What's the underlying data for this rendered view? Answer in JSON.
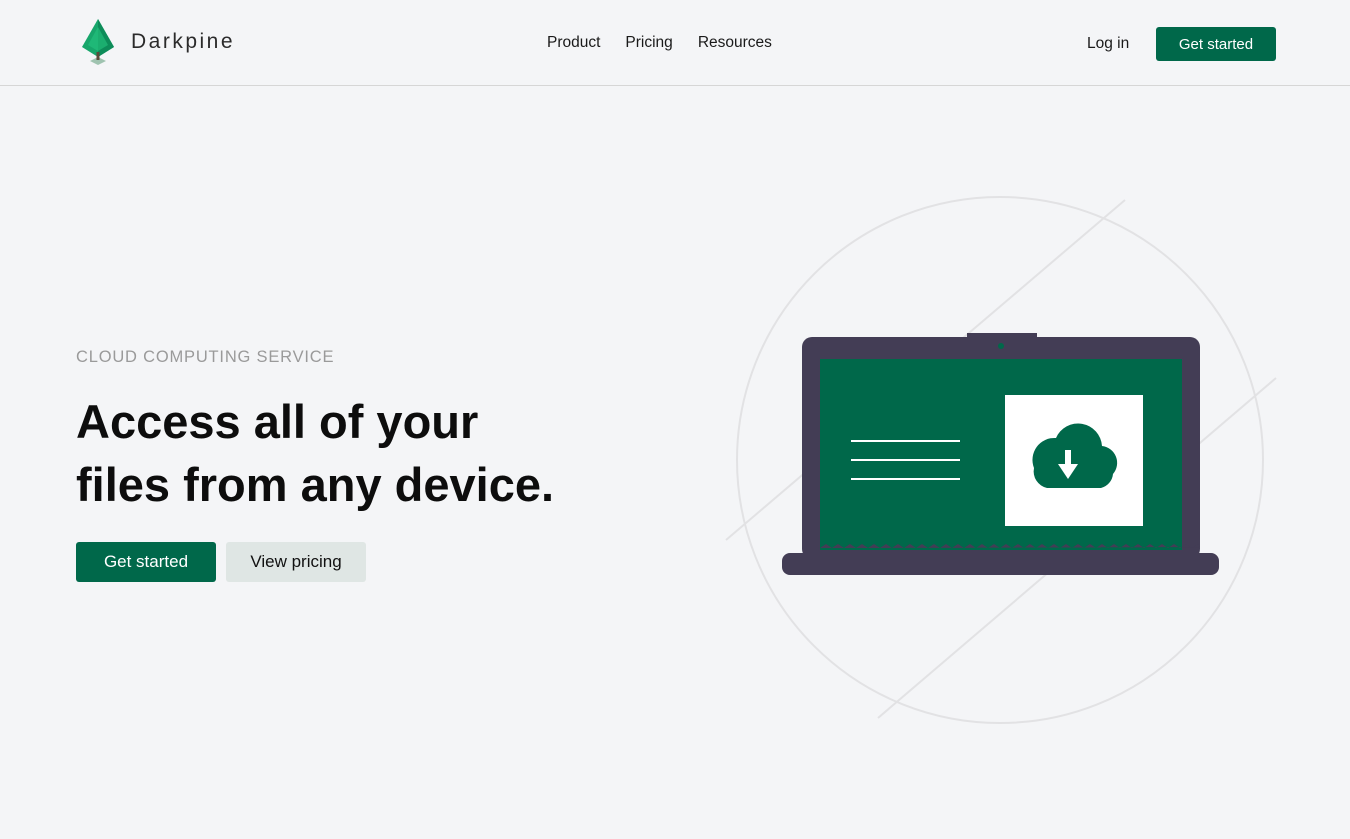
{
  "brand": {
    "name": "Darkpine",
    "logo_icon": "pine-tree-icon",
    "color": "#00684a"
  },
  "nav": {
    "items": [
      {
        "label": "Product"
      },
      {
        "label": "Pricing"
      },
      {
        "label": "Resources"
      }
    ],
    "login_label": "Log in",
    "cta_label": "Get started"
  },
  "hero": {
    "eyebrow": "CLOUD COMPUTING SERVICE",
    "headline_line1": "Access all of your",
    "headline_line2": "files from any device.",
    "primary_button": "Get started",
    "secondary_button": "View pricing"
  },
  "illustration": {
    "icons": [
      "laptop-icon",
      "cloud-download-icon"
    ]
  },
  "colors": {
    "accent": "#00684a",
    "background": "#f4f5f7",
    "secondary_button": "#dfe6e4",
    "laptop_frame": "#433d55"
  }
}
